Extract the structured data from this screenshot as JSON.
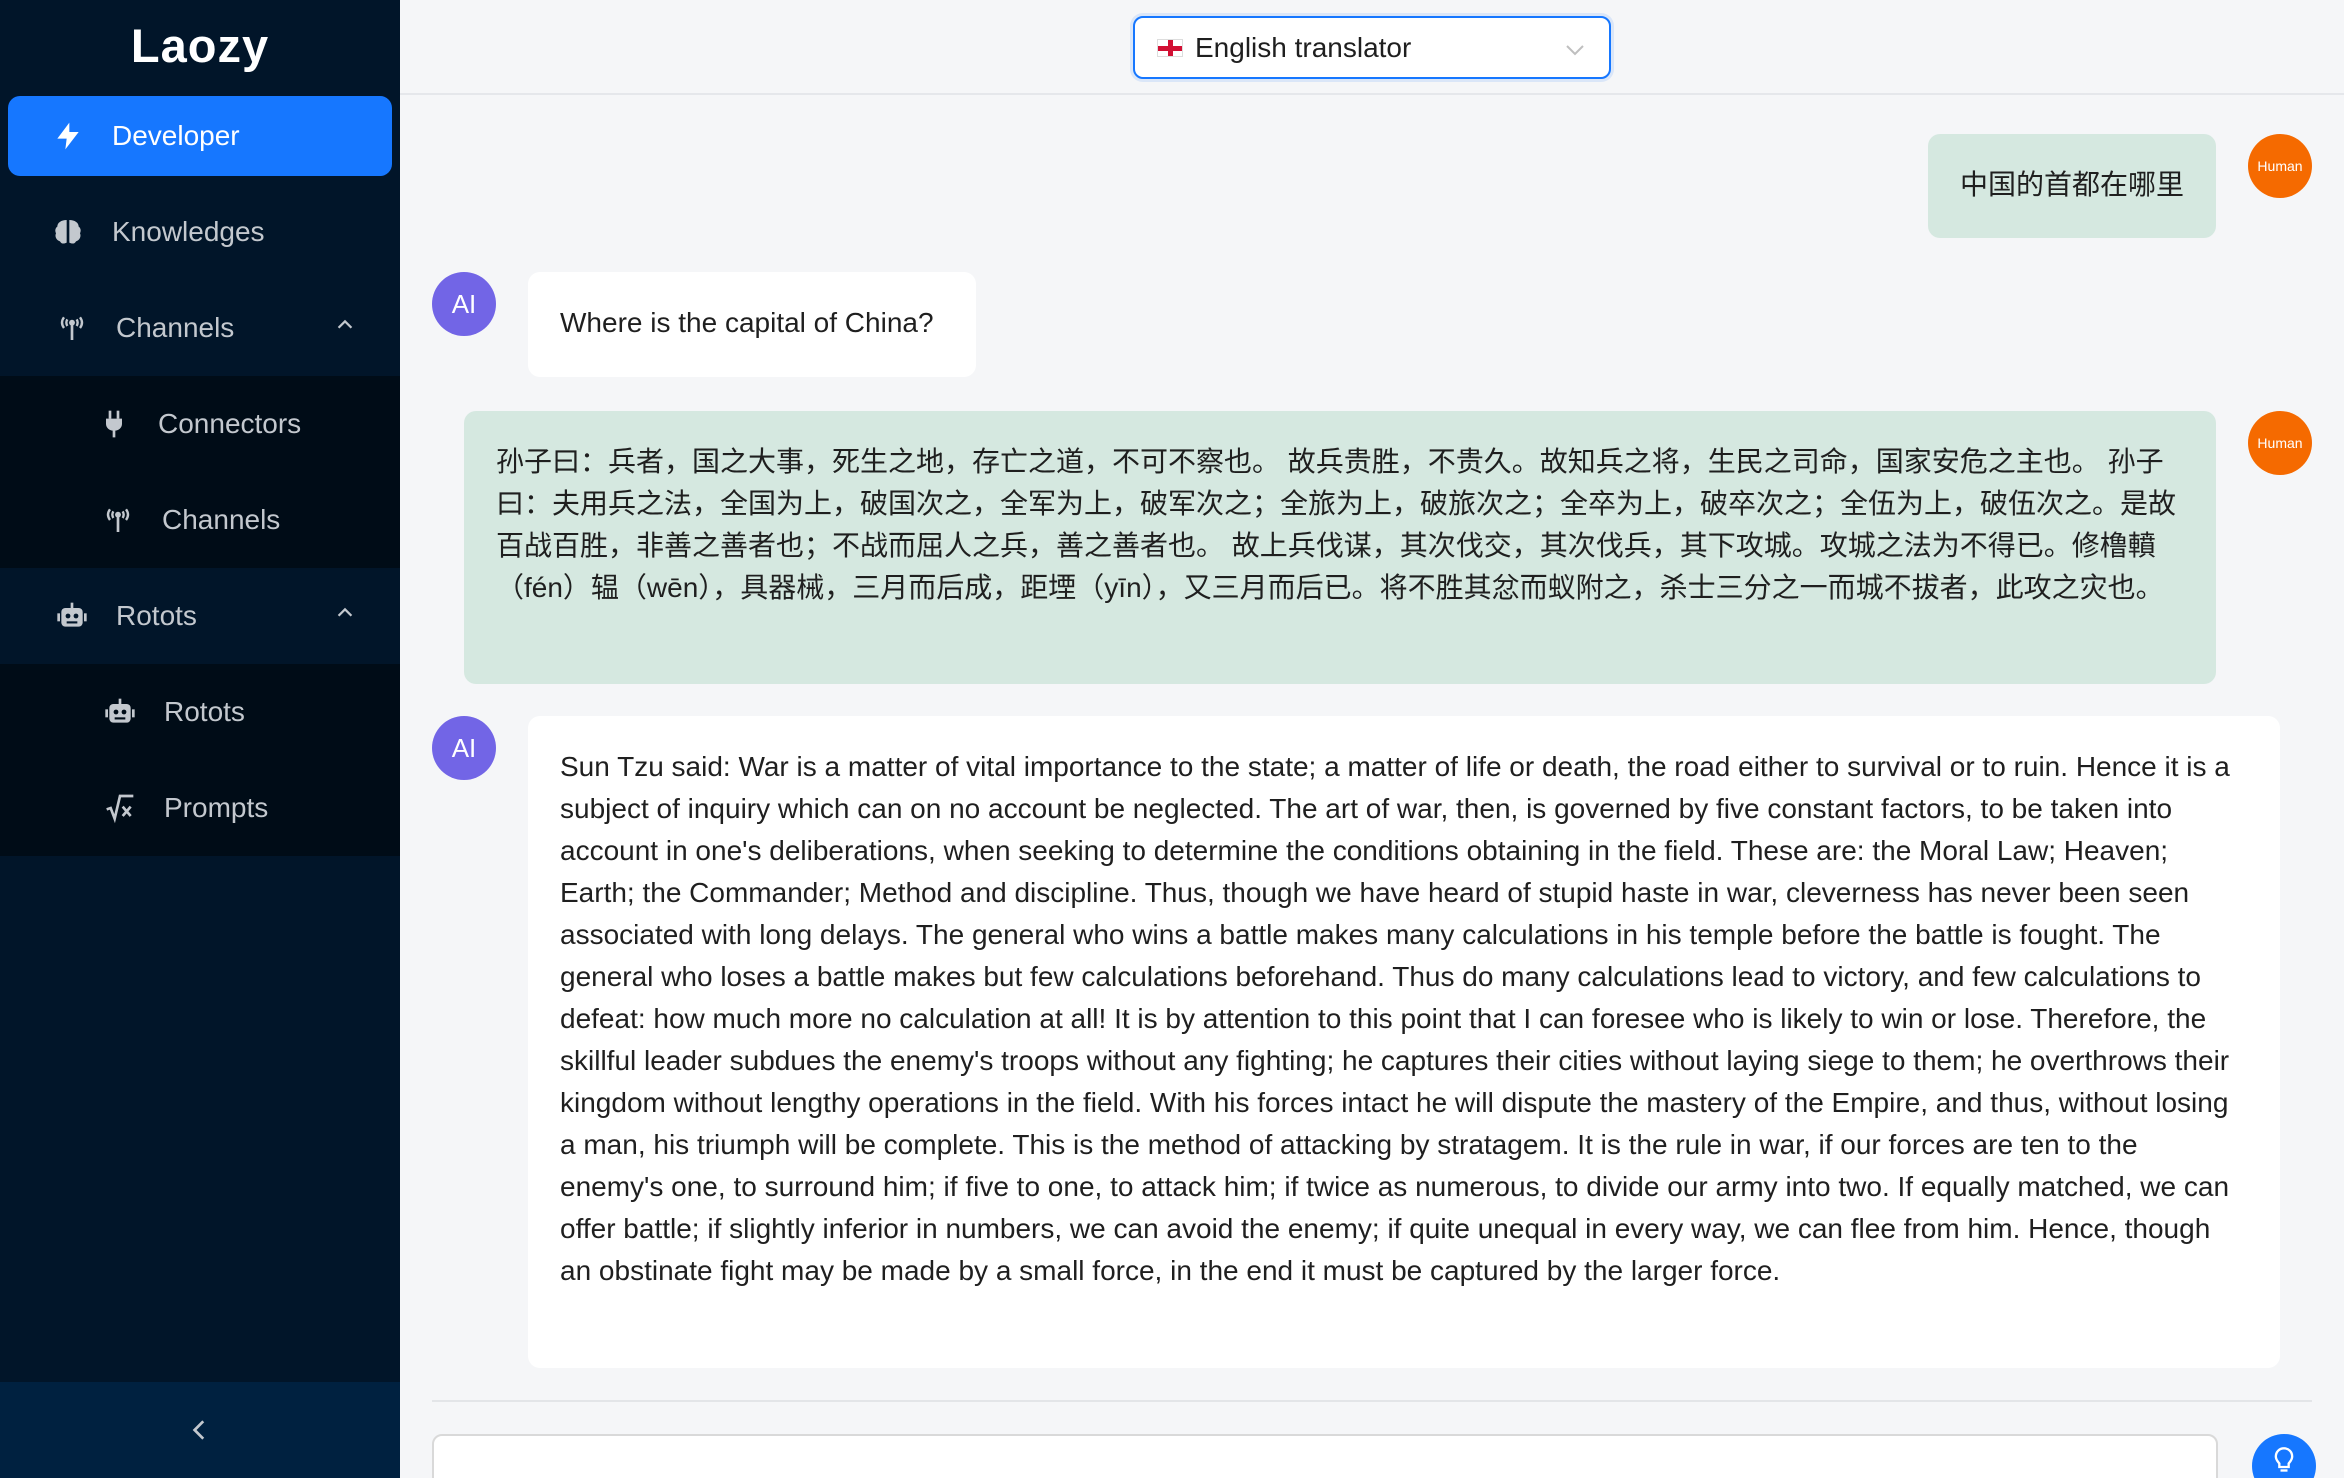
{
  "app": {
    "title": "Laozy"
  },
  "sidebar": {
    "items": [
      {
        "label": "Developer",
        "icon": "bolt-icon",
        "active": true
      },
      {
        "label": "Knowledges",
        "icon": "brain-icon"
      },
      {
        "label": "Channels",
        "icon": "antenna-icon",
        "expanded": true,
        "children": [
          {
            "label": "Connectors",
            "icon": "plug-icon"
          },
          {
            "label": "Channels",
            "icon": "antenna-icon"
          }
        ]
      },
      {
        "label": "Rotots",
        "icon": "robot-icon",
        "expanded": true,
        "children": [
          {
            "label": "Rotots",
            "icon": "robot-icon"
          },
          {
            "label": "Prompts",
            "icon": "function-icon"
          }
        ]
      }
    ],
    "collapse_icon": "chevron-left-icon"
  },
  "header": {
    "selector": {
      "value": "English translator",
      "flag_icon": "england-flag-icon"
    }
  },
  "chat": {
    "messages": [
      {
        "role": "human",
        "avatar": "Human",
        "text": "中国的首都在哪里"
      },
      {
        "role": "ai",
        "avatar": "AI",
        "text": "Where is the capital of China?"
      },
      {
        "role": "human",
        "avatar": "Human",
        "text": "孙子曰：兵者，国之大事，死生之地，存亡之道，不可不察也。 故兵贵胜，不贵久。故知兵之将，生民之司命，国家安危之主也。 孙子曰：夫用兵之法，全国为上，破国次之，全军为上，破军次之；全旅为上，破旅次之；全卒为上，破卒次之；全伍为上，破伍次之。是故百战百胜，非善之善者也；不战而屈人之兵，善之善者也。 故上兵伐谋，其次伐交，其次伐兵，其下攻城。攻城之法为不得已。修橹轒（fén）辒（wēn），具器械，三月而后成，距堙（yīn），又三月而后已。将不胜其忿而蚁附之，杀士三分之一而城不拔者，此攻之灾也。"
      },
      {
        "role": "ai",
        "avatar": "AI",
        "text": "Sun Tzu said: War is a matter of vital importance to the state; a matter of life or death, the road either to survival or to ruin. Hence it is a subject of inquiry which can on no account be neglected. The art of war, then, is governed by five constant factors, to be taken into account in one's deliberations, when seeking to determine the conditions obtaining in the field. These are: the Moral Law; Heaven; Earth; the Commander; Method and discipline. Thus, though we have heard of stupid haste in war, cleverness has never been seen associated with long delays. The general who wins a battle makes many calculations in his temple before the battle is fought. The general who loses a battle makes but few calculations beforehand. Thus do many calculations lead to victory, and few calculations to defeat: how much more no calculation at all! It is by attention to this point that I can foresee who is likely to win or lose. Therefore, the skillful leader subdues the enemy's troops without any fighting; he captures their cities without laying siege to them; he overthrows their kingdom without lengthy operations in the field. With his forces intact he will dispute the mastery of the Empire, and thus, without losing a man, his triumph will be complete. This is the method of attacking by stratagem. It is the rule in war, if our forces are ten to the enemy's one, to surround him; if five to one, to attack him; if twice as numerous, to divide our army into two. If equally matched, we can offer battle; if slightly inferior in numbers, we can avoid the enemy; if quite unequal in every way, we can flee from him. Hence, though an obstinate fight may be made by a small force, in the end it must be captured by the larger force."
      }
    ]
  },
  "composer": {
    "send_icon": "lightbulb-icon"
  },
  "colors": {
    "sidebar_bg": "#011529",
    "accent": "#1677ff",
    "human_bubble": "#d5e8e0",
    "human_avatar": "#f56a00",
    "ai_avatar": "#7265e6"
  }
}
